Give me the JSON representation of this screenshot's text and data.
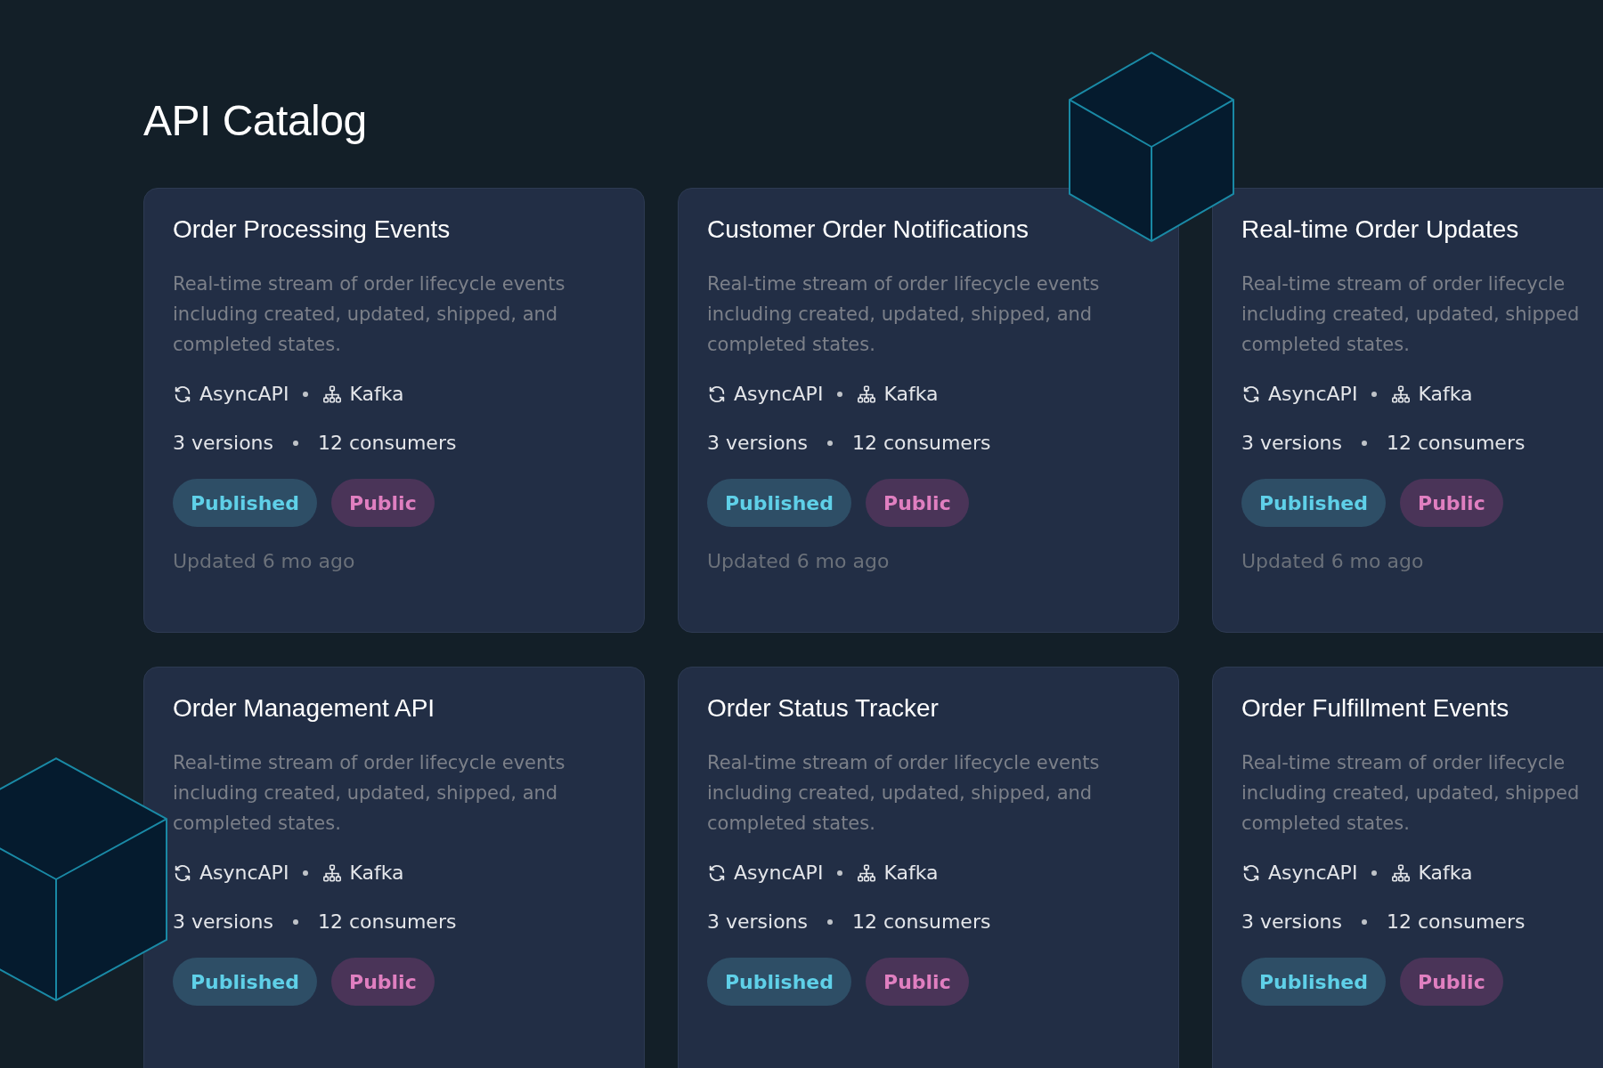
{
  "page": {
    "title": "API Catalog"
  },
  "cards": [
    {
      "title": "Order Processing Events",
      "description": "Real-time stream of order lifecycle events\nincluding created, updated, shipped, and\ncompleted states.",
      "spec": "AsyncAPI",
      "protocol": "Kafka",
      "versions": "3 versions",
      "consumers": "12 consumers",
      "badges": [
        {
          "label": "Published",
          "kind": "status"
        },
        {
          "label": "Public",
          "kind": "visibility"
        }
      ],
      "updated": "Updated 6 mo ago"
    },
    {
      "title": "Customer Order Notifications",
      "description": "Real-time stream of order lifecycle events\nincluding created, updated, shipped, and\ncompleted states.",
      "spec": "AsyncAPI",
      "protocol": "Kafka",
      "versions": "3 versions",
      "consumers": "12 consumers",
      "badges": [
        {
          "label": "Published",
          "kind": "status"
        },
        {
          "label": "Public",
          "kind": "visibility"
        }
      ],
      "updated": "Updated 6 mo ago"
    },
    {
      "title": "Real-time Order Updates",
      "description": "Real-time stream of order lifecycle\nincluding created, updated, shipped\ncompleted states.",
      "spec": "AsyncAPI",
      "protocol": "Kafka",
      "versions": "3 versions",
      "consumers": "12 consumers",
      "badges": [
        {
          "label": "Published",
          "kind": "status"
        },
        {
          "label": "Public",
          "kind": "visibility"
        }
      ],
      "updated": "Updated 6 mo ago"
    },
    {
      "title": "Order Management API",
      "description": "Real-time stream of order lifecycle events\nincluding created, updated, shipped, and\ncompleted states.",
      "spec": "AsyncAPI",
      "protocol": "Kafka",
      "versions": "3 versions",
      "consumers": "12 consumers",
      "badges": [
        {
          "label": "Published",
          "kind": "status"
        },
        {
          "label": "Public",
          "kind": "visibility"
        }
      ]
    },
    {
      "title": "Order Status Tracker",
      "description": "Real-time stream of order lifecycle events\nincluding created, updated, shipped, and\ncompleted states.",
      "spec": "AsyncAPI",
      "protocol": "Kafka",
      "versions": "3 versions",
      "consumers": "12 consumers",
      "badges": [
        {
          "label": "Published",
          "kind": "status"
        },
        {
          "label": "Public",
          "kind": "visibility"
        }
      ]
    },
    {
      "title": "Order Fulfillment Events",
      "description": "Real-time stream of order lifecycle\nincluding created, updated, shipped\ncompleted states.",
      "spec": "AsyncAPI",
      "protocol": "Kafka",
      "versions": "3 versions",
      "consumers": "12 consumers",
      "badges": [
        {
          "label": "Published",
          "kind": "status"
        },
        {
          "label": "Public",
          "kind": "visibility"
        }
      ]
    }
  ]
}
